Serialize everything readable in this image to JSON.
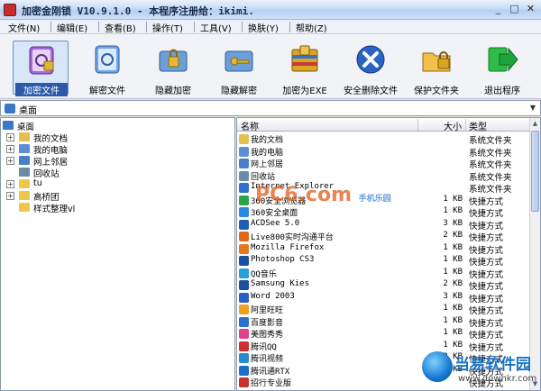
{
  "window": {
    "title": "加密金刚锁 V10.9.1.0 - 本程序注册给：ikimi.",
    "minimize": "_",
    "maximize": "□",
    "close": "✕"
  },
  "menu": [
    {
      "label": "文件(N)"
    },
    {
      "label": "编辑(E)"
    },
    {
      "label": "查看(B)"
    },
    {
      "label": "操作(T)"
    },
    {
      "label": "工具(V)"
    },
    {
      "label": "换肤(Y)"
    },
    {
      "label": "帮助(Z)"
    }
  ],
  "toolbar": [
    {
      "label": "加密文件",
      "icon": "encrypt-file-icon",
      "color": "#9b5bd6",
      "active": true
    },
    {
      "label": "解密文件",
      "icon": "decrypt-file-icon",
      "color": "#4f8fd8"
    },
    {
      "label": "隐藏加密",
      "icon": "hide-encrypt-icon",
      "color": "#3a7cc6"
    },
    {
      "label": "隐藏解密",
      "icon": "hide-decrypt-icon",
      "color": "#3a7cc6"
    },
    {
      "label": "加密为EXE",
      "icon": "encrypt-exe-icon",
      "color": "#d8a020"
    },
    {
      "label": "安全删除文件",
      "icon": "secure-delete-icon",
      "color": "#2558b8"
    },
    {
      "label": "保护文件夹",
      "icon": "protect-folder-icon",
      "color": "#e0a020"
    },
    {
      "label": "退出程序",
      "icon": "exit-icon",
      "color": "#1aa836"
    }
  ],
  "address": {
    "value": "桌面"
  },
  "tree": {
    "root": "桌面",
    "items": [
      {
        "label": "我的文档",
        "expander": "+",
        "color": "#e5c04f"
      },
      {
        "label": "我的电脑",
        "expander": "+",
        "color": "#5b8ed6"
      },
      {
        "label": "网上邻居",
        "expander": "+",
        "color": "#4a7fc8"
      },
      {
        "label": "回收站",
        "expander": "",
        "color": "#6b8ca8"
      },
      {
        "label": "tu",
        "expander": "+",
        "color": "#f0c64a"
      },
      {
        "label": "高桥团",
        "expander": "+",
        "color": "#f0c64a"
      },
      {
        "label": "样式整理vl",
        "expander": "",
        "color": "#f0c64a"
      }
    ]
  },
  "list": {
    "headers": {
      "name": "名称",
      "size": "大小",
      "type": "类型"
    },
    "rows": [
      {
        "name": "我的文档",
        "size": "",
        "type": "系统文件夹",
        "color": "#e5c04f"
      },
      {
        "name": "我的电脑",
        "size": "",
        "type": "系统文件夹",
        "color": "#5b8ed6"
      },
      {
        "name": "网上邻居",
        "size": "",
        "type": "系统文件夹",
        "color": "#4a7fc8"
      },
      {
        "name": "回收站",
        "size": "",
        "type": "系统文件夹",
        "color": "#6b8ca8"
      },
      {
        "name": "Internet Explorer",
        "size": "",
        "type": "系统文件夹",
        "color": "#2f6fd0"
      },
      {
        "name": "360安全浏览器",
        "size": "1 KB",
        "type": "快捷方式",
        "color": "#2aa54a"
      },
      {
        "name": "360安全桌面",
        "size": "1 KB",
        "type": "快捷方式",
        "color": "#2a8ae0"
      },
      {
        "name": "ACDSee 5.0",
        "size": "3 KB",
        "type": "快捷方式",
        "color": "#1f5fb0"
      },
      {
        "name": "Live800实时沟通平台",
        "size": "2 KB",
        "type": "快捷方式",
        "color": "#e06a1c"
      },
      {
        "name": "Mozilla Firefox",
        "size": "1 KB",
        "type": "快捷方式",
        "color": "#e07a1c"
      },
      {
        "name": "Photoshop CS3",
        "size": "1 KB",
        "type": "快捷方式",
        "color": "#1e4f9e"
      },
      {
        "name": "QQ音乐",
        "size": "1 KB",
        "type": "快捷方式",
        "color": "#25a0d8"
      },
      {
        "name": "Samsung Kies",
        "size": "2 KB",
        "type": "快捷方式",
        "color": "#1b4fa0"
      },
      {
        "name": "Word 2003",
        "size": "3 KB",
        "type": "快捷方式",
        "color": "#2a5fc0"
      },
      {
        "name": "阿里旺旺",
        "size": "1 KB",
        "type": "快捷方式",
        "color": "#f0a020"
      },
      {
        "name": "百度影音",
        "size": "1 KB",
        "type": "快捷方式",
        "color": "#2a70d0"
      },
      {
        "name": "美图秀秀",
        "size": "1 KB",
        "type": "快捷方式",
        "color": "#e2408a"
      },
      {
        "name": "腾讯QQ",
        "size": "1 KB",
        "type": "快捷方式",
        "color": "#d03030"
      },
      {
        "name": "腾讯视频",
        "size": "2 KB",
        "type": "快捷方式",
        "color": "#2a8ad0"
      },
      {
        "name": "腾讯通RTX",
        "size": "1 KB",
        "type": "快捷方式",
        "color": "#1e6ec8"
      },
      {
        "name": "招行专业版",
        "size": "",
        "type": "快捷方式",
        "color": "#c83030"
      }
    ]
  },
  "watermarks": {
    "overlay": "PC6.com",
    "overlay_sub": "手机乐园",
    "corner_title": "当易软件园",
    "corner_url": "www.downkr.com"
  }
}
